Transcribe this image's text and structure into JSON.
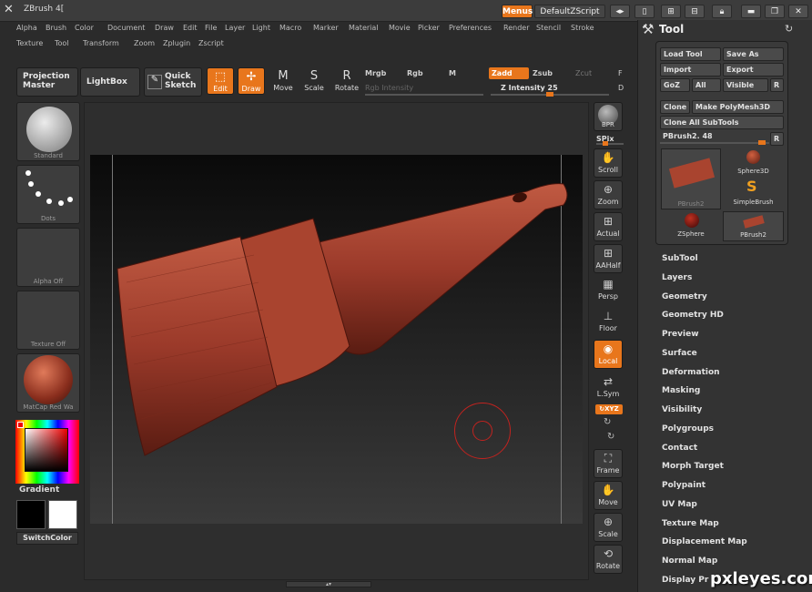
{
  "titlebar": {
    "title": "ZBrush 4[",
    "menus_btn": "Menus",
    "script_btn": "DefaultZScript"
  },
  "menu": [
    "Alpha",
    "Brush",
    "Color",
    "Document",
    "Draw",
    "Edit",
    "File",
    "Layer",
    "Light",
    "Macro",
    "Marker",
    "Material",
    "Movie",
    "Picker",
    "Preferences",
    "Render",
    "Stencil",
    "Stroke",
    "Texture",
    "Tool",
    "Transform",
    "Zoom",
    "Zplugin",
    "Zscript"
  ],
  "shelf": {
    "projection_master": "Projection Master",
    "lightbox": "LightBox",
    "quick_sketch": "Quick Sketch",
    "edit": "Edit",
    "draw": "Draw",
    "move": "Move",
    "scale": "Scale",
    "rotate": "Rotate",
    "mrgb": "Mrgb",
    "rgb": "Rgb",
    "m": "M",
    "zadd": "Zadd",
    "zsub": "Zsub",
    "zcut": "Zcut",
    "rgb_intensity": "Rgb Intensity",
    "z_intensity": "Z Intensity 25",
    "f_label": "F",
    "d_label": "D"
  },
  "left": {
    "standard": "Standard",
    "dots": "Dots",
    "alpha": "Alpha Off",
    "texture": "Texture Off",
    "matcap": "MatCap Red Wa",
    "gradient": "Gradient",
    "switch": "SwitchColor"
  },
  "right_tools": {
    "bpr": "BPR",
    "spix": "SPix",
    "scroll": "Scroll",
    "zoom": "Zoom",
    "actual": "Actual",
    "aahalf": "AAHalf",
    "persp": "Persp",
    "floor": "Floor",
    "local": "Local",
    "lsym": "L.Sym",
    "xyz": "↻XYZ",
    "frame": "Frame",
    "move": "Move",
    "scale": "Scale",
    "rotate": "Rotate"
  },
  "tool_panel": {
    "title": "Tool",
    "load": "Load Tool",
    "save": "Save As",
    "import": "Import",
    "export": "Export",
    "goz": "GoZ",
    "all": "All",
    "visible": "Visible",
    "r": "R",
    "clone": "Clone",
    "make_poly": "Make PolyMesh3D",
    "clone_all": "Clone All SubTools",
    "slider": "PBrush2. 48",
    "r2": "R",
    "thumbs": [
      "PBrush2",
      "Sphere3D",
      "SimpleBrush",
      "ZSphere",
      "PBrush2"
    ]
  },
  "sections": [
    "SubTool",
    "Layers",
    "Geometry",
    "Geometry HD",
    "Preview",
    "Surface",
    "Deformation",
    "Masking",
    "Visibility",
    "Polygroups",
    "Contact",
    "Morph Target",
    "Polypaint",
    "UV Map",
    "Texture Map",
    "Displacement Map",
    "Normal Map",
    "Display Pr"
  ],
  "watermark": "pxleyes.com",
  "colors": {
    "accent": "#e8761c",
    "clay": "#9b3a2a"
  }
}
